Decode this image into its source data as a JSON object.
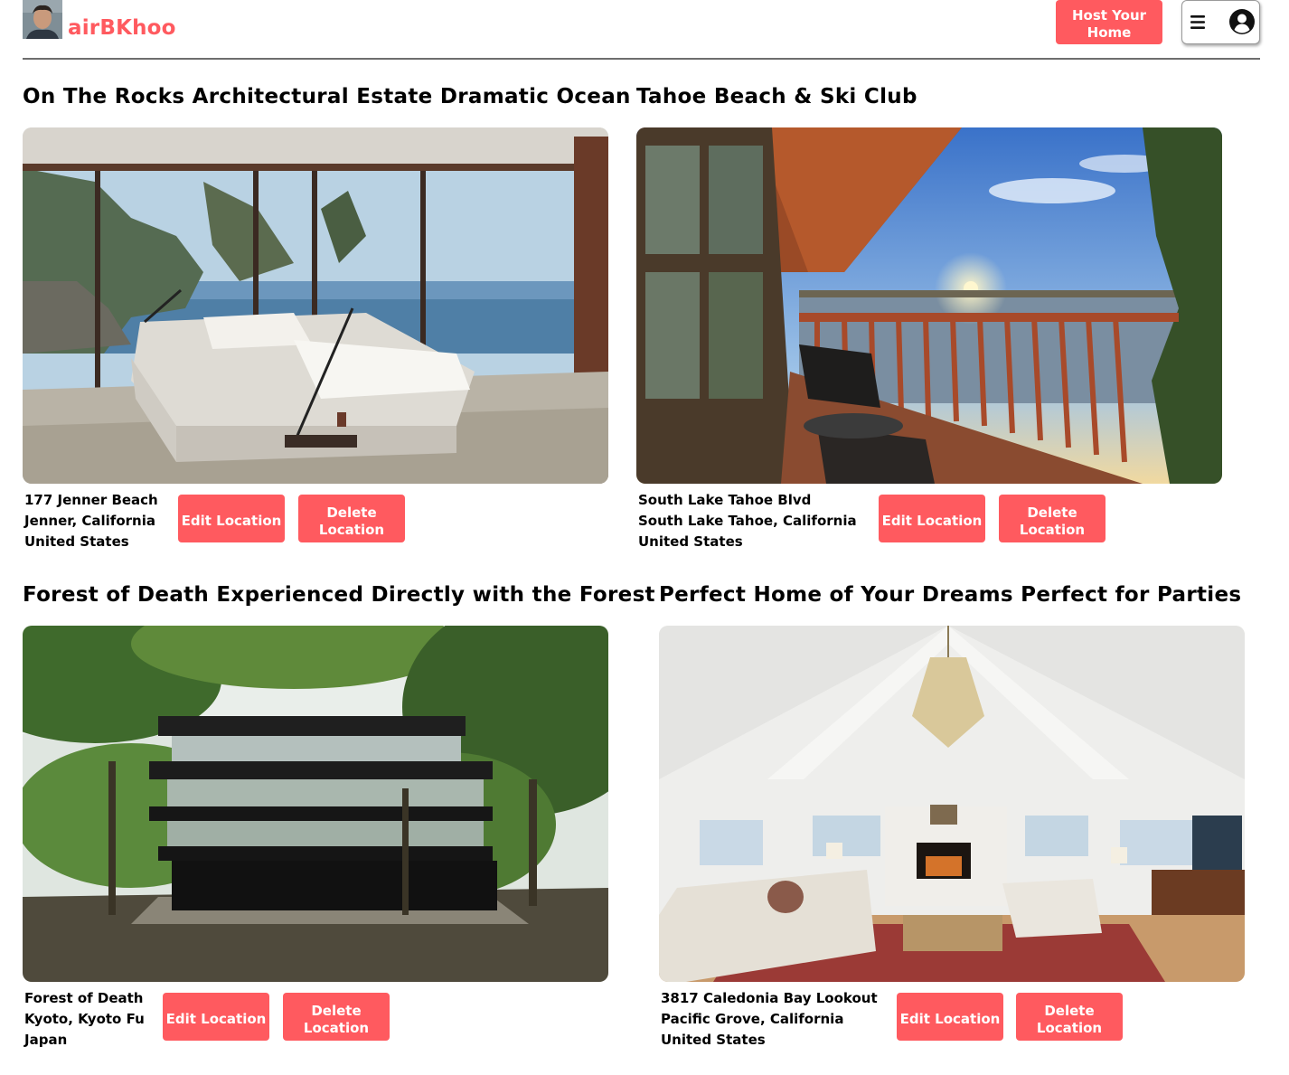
{
  "header": {
    "logo_text": "airBKhoo",
    "host_button": "Host Your Home",
    "menu_icon": "hamburger-icon",
    "user_icon": "user-circle-icon"
  },
  "colors": {
    "brand": "#FF5A5F",
    "divider": "#6e6e6e"
  },
  "spots": [
    {
      "title": "On The Rocks Architectural Estate Dramatic Ocean",
      "address": "177 Jenner Beach",
      "city_state": "Jenner, California",
      "country": "United States",
      "edit_label": "Edit Location",
      "delete_label": "Delete Location"
    },
    {
      "title": "Tahoe Beach & Ski Club",
      "address": "South Lake Tahoe Blvd",
      "city_state": "South Lake Tahoe, California",
      "country": "United States",
      "edit_label": "Edit Location",
      "delete_label": "Delete Location"
    },
    {
      "title": "Forest of Death Experienced Directly with the Forest",
      "address": "Forest of Death",
      "city_state": "Kyoto, Kyoto Fu",
      "country": "Japan",
      "edit_label": "Edit Location",
      "delete_label": "Delete Location"
    },
    {
      "title": "Perfect Home of Your Dreams Perfect for Parties",
      "address": "3817 Caledonia Bay Lookout",
      "city_state": "Pacific Grove, California",
      "country": "United States",
      "edit_label": "Edit Location",
      "delete_label": "Delete Location"
    }
  ]
}
